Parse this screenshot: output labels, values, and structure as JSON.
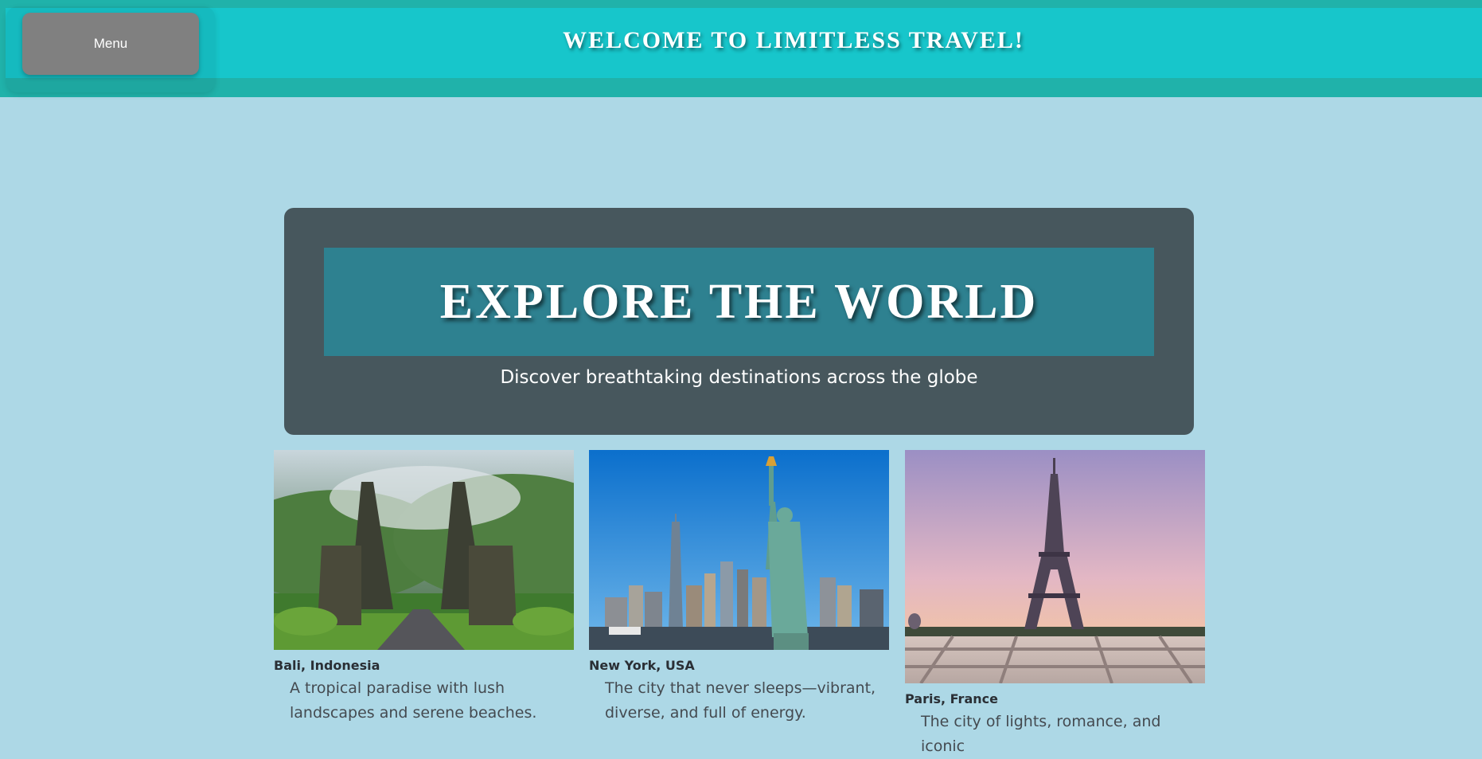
{
  "header": {
    "menu_label": "Menu",
    "title": "WELCOME TO LIMITLESS TRAVEL!"
  },
  "hero": {
    "heading": "EXPLORE THE WORLD",
    "subtitle": "Discover breathtaking destinations across the globe"
  },
  "destinations": [
    {
      "name": "Bali, Indonesia",
      "description": "A tropical paradise with lush landscapes and serene beaches.",
      "image": "bali-gate-photo"
    },
    {
      "name": "New York, USA",
      "description": "The city that never sleeps—vibrant, diverse, and full of energy.",
      "image": "statue-of-liberty-photo"
    },
    {
      "name": "Paris, France",
      "description": "The city of lights, romance, and iconic",
      "image": "eiffel-tower-photo"
    }
  ],
  "colors": {
    "page_bg": "#add8e6",
    "header_bar": "#20b2aa",
    "header_inner": "#17c6cb",
    "menu_button": "#808080",
    "hero_bg": "#47575d",
    "hero_banner": "#2e8190"
  }
}
